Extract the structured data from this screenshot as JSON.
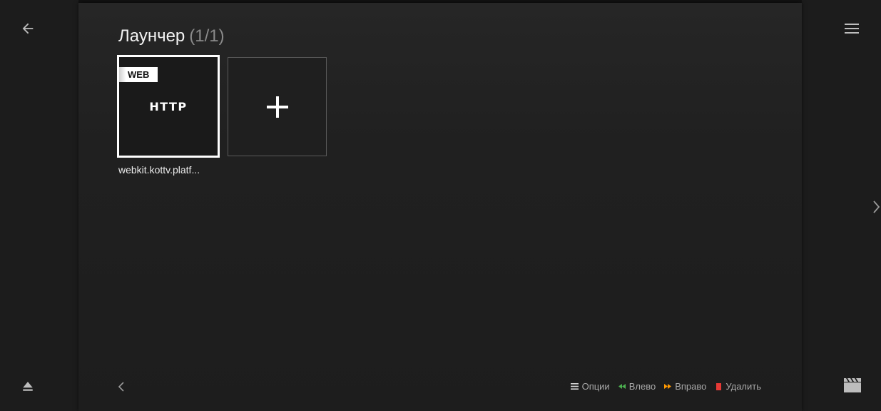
{
  "header": {
    "title": "Лаунчер",
    "count": "(1/1)"
  },
  "nav": {
    "back_icon": "arrow-left-icon",
    "menu_icon": "hamburger-menu-icon",
    "eject_icon": "eject-icon",
    "clip_icon": "clapperboard-icon",
    "next_icon": "chevron-right-icon",
    "prev_page_icon": "chevron-left-icon"
  },
  "tiles": [
    {
      "badge": "WEB",
      "logo_text": "HTTP",
      "caption": "webkit.kottv.platf..."
    },
    {
      "icon": "plus-icon"
    }
  ],
  "hints": [
    {
      "label": "Опции",
      "icon": "menu-lines-icon",
      "color": "#d8d8d8"
    },
    {
      "label": "Влево",
      "icon": "rewind-icon",
      "color": "#4caf50"
    },
    {
      "label": "Вправо",
      "icon": "fast-forward-icon",
      "color": "#ff9800"
    },
    {
      "label": "Удалить",
      "icon": "square-icon",
      "color": "#e53935"
    }
  ],
  "colors": {
    "background": "#1c1c1c",
    "panel": "#222222",
    "focus_border": "#ffffff"
  }
}
